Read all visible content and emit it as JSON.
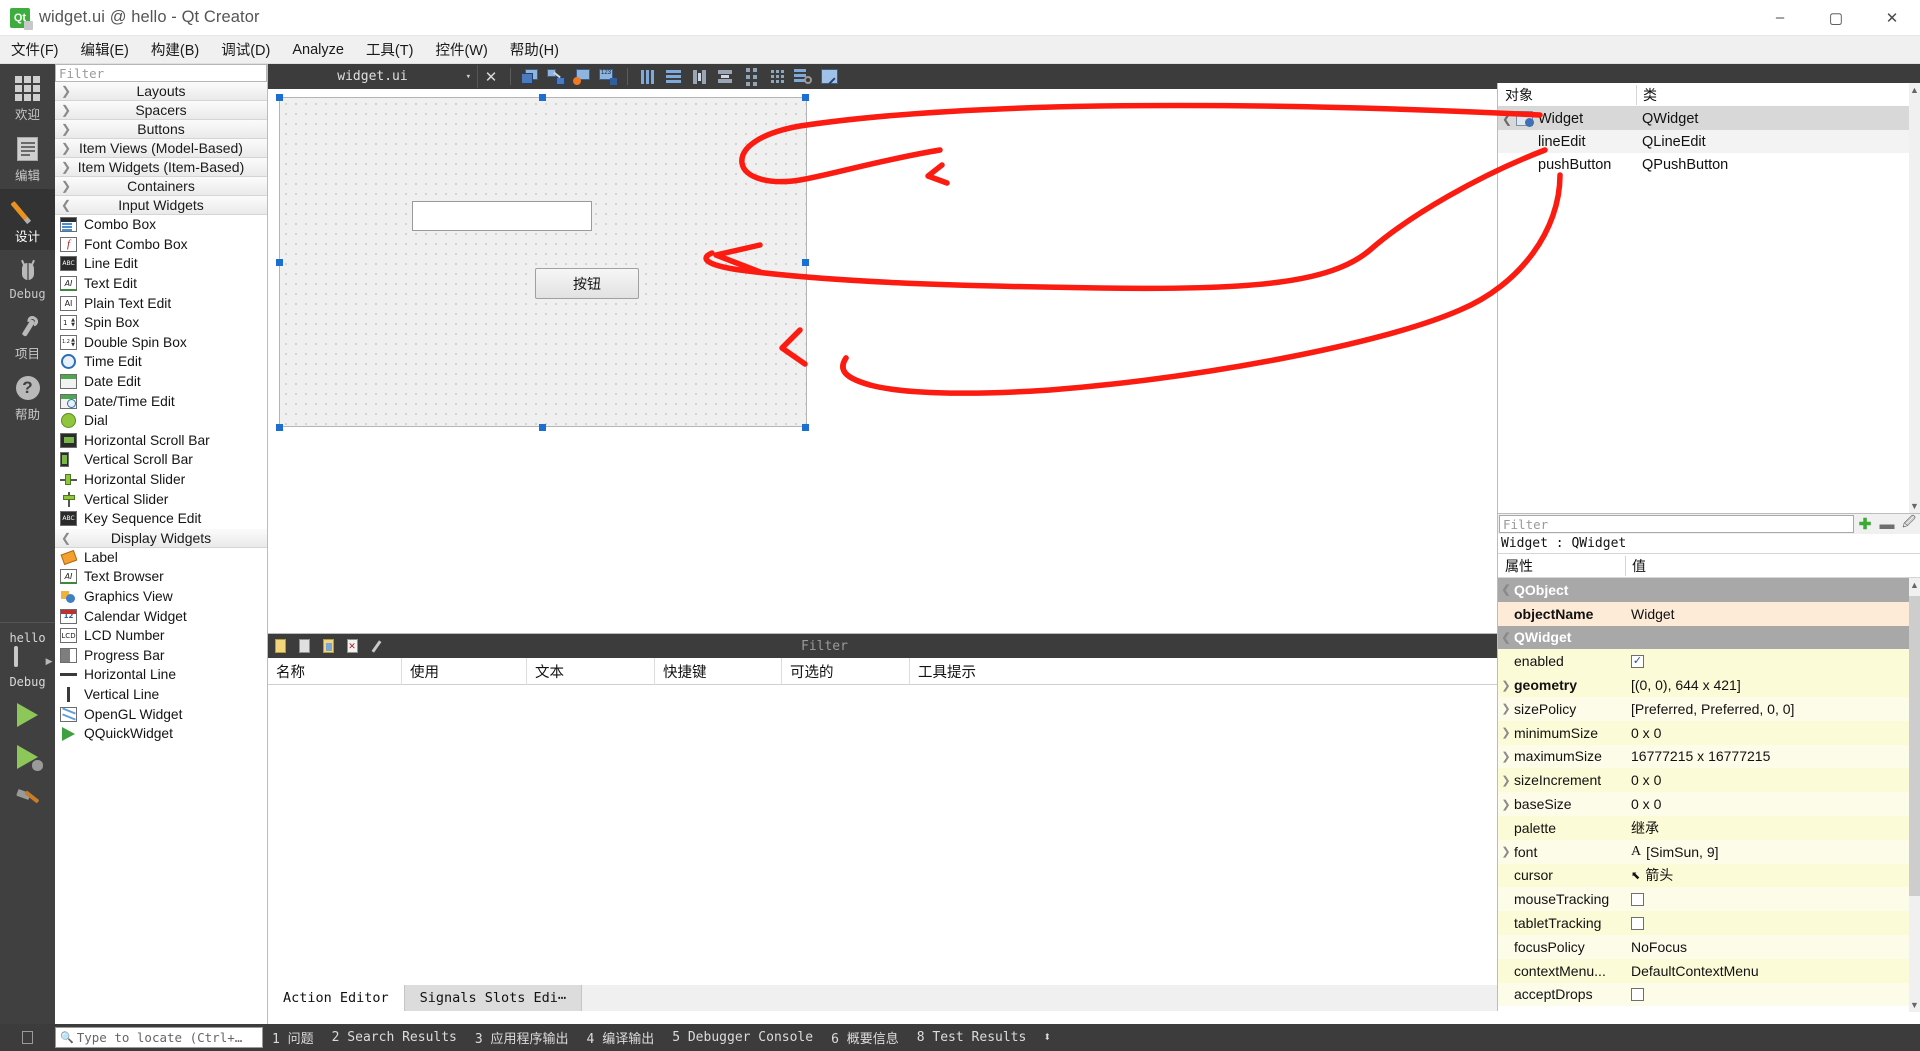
{
  "window": {
    "title": "widget.ui @ hello - Qt Creator",
    "app_icon": "qt-logo-icon",
    "minimize": "–",
    "maximize": "▢",
    "close": "✕"
  },
  "menubar": {
    "items": [
      {
        "label": "文件(F)",
        "name": "menu-file"
      },
      {
        "label": "编辑(E)",
        "name": "menu-edit"
      },
      {
        "label": "构建(B)",
        "name": "menu-build"
      },
      {
        "label": "调试(D)",
        "name": "menu-debug"
      },
      {
        "label": "Analyze",
        "name": "menu-analyze"
      },
      {
        "label": "工具(T)",
        "name": "menu-tools"
      },
      {
        "label": "控件(W)",
        "name": "menu-window"
      },
      {
        "label": "帮助(H)",
        "name": "menu-help"
      }
    ]
  },
  "modebar": {
    "modes": [
      {
        "label": "欢迎",
        "icon": "grid-icon",
        "active": false
      },
      {
        "label": "编辑",
        "icon": "document-icon",
        "active": false
      },
      {
        "label": "设计",
        "icon": "pencil-icon",
        "active": true
      },
      {
        "label": "Debug",
        "icon": "bug-icon",
        "active": false
      },
      {
        "label": "项目",
        "icon": "wrench-icon",
        "active": false
      },
      {
        "label": "帮助",
        "icon": "question-icon",
        "active": false
      }
    ],
    "kit": {
      "project": "hello",
      "config": "Debug",
      "icon": "monitor-icon"
    },
    "run_buttons": [
      {
        "name": "run-button",
        "icon": "play-icon"
      },
      {
        "name": "debug-button",
        "icon": "play-bug-icon"
      },
      {
        "name": "build-button",
        "icon": "hammer-icon"
      }
    ]
  },
  "widgetbox": {
    "filter_placeholder": "Filter",
    "groups": [
      {
        "label": "Layouts",
        "expanded": false
      },
      {
        "label": "Spacers",
        "expanded": false
      },
      {
        "label": "Buttons",
        "expanded": false
      },
      {
        "label": "Item Views (Model-Based)",
        "expanded": false
      },
      {
        "label": "Item Widgets (Item-Based)",
        "expanded": false
      },
      {
        "label": "Containers",
        "expanded": false
      },
      {
        "label": "Input Widgets",
        "expanded": true,
        "items": [
          {
            "label": "Combo Box",
            "icon": "combobox-icon"
          },
          {
            "label": "Font Combo Box",
            "icon": "fontcombobox-icon"
          },
          {
            "label": "Line Edit",
            "icon": "lineedit-icon"
          },
          {
            "label": "Text Edit",
            "icon": "textedit-icon"
          },
          {
            "label": "Plain Text Edit",
            "icon": "plaintextedit-icon"
          },
          {
            "label": "Spin Box",
            "icon": "spinbox-icon"
          },
          {
            "label": "Double Spin Box",
            "icon": "doublespinbox-icon"
          },
          {
            "label": "Time Edit",
            "icon": "clock-icon"
          },
          {
            "label": "Date Edit",
            "icon": "calendar-icon"
          },
          {
            "label": "Date/Time Edit",
            "icon": "calendar-clock-icon"
          },
          {
            "label": "Dial",
            "icon": "dial-icon"
          },
          {
            "label": "Horizontal Scroll Bar",
            "icon": "hscrollbar-icon"
          },
          {
            "label": "Vertical Scroll Bar",
            "icon": "vscrollbar-icon"
          },
          {
            "label": "Horizontal Slider",
            "icon": "hslider-icon"
          },
          {
            "label": "Vertical Slider",
            "icon": "vslider-icon"
          },
          {
            "label": "Key Sequence Edit",
            "icon": "keysequence-icon"
          }
        ]
      },
      {
        "label": "Display Widgets",
        "expanded": true,
        "items": [
          {
            "label": "Label",
            "icon": "label-icon"
          },
          {
            "label": "Text Browser",
            "icon": "textbrowser-icon"
          },
          {
            "label": "Graphics View",
            "icon": "graphicsview-icon"
          },
          {
            "label": "Calendar Widget",
            "icon": "calendarwidget-icon"
          },
          {
            "label": "LCD Number",
            "icon": "lcdnumber-icon"
          },
          {
            "label": "Progress Bar",
            "icon": "progressbar-icon"
          },
          {
            "label": "Horizontal Line",
            "icon": "hline-icon"
          },
          {
            "label": "Vertical Line",
            "icon": "vline-icon"
          },
          {
            "label": "OpenGL Widget",
            "icon": "opengl-icon"
          },
          {
            "label": "QQuickWidget",
            "icon": "qquickwidget-icon"
          }
        ]
      }
    ]
  },
  "designer_toolbar": {
    "file_combo": "widget.ui",
    "buttons": [
      {
        "name": "close-document-button",
        "icon": "close-icon"
      },
      {
        "name": "edit-widgets-button",
        "icon": "edit-widgets-icon"
      },
      {
        "name": "edit-signals-slots-button",
        "icon": "signals-slots-icon"
      },
      {
        "name": "edit-buddies-button",
        "icon": "buddies-icon"
      },
      {
        "name": "edit-tab-order-button",
        "icon": "tab-order-icon"
      },
      {
        "name": "layout-horizontally-button",
        "icon": "layout-h-icon"
      },
      {
        "name": "layout-vertically-button",
        "icon": "layout-v-icon"
      },
      {
        "name": "layout-splitter-h-button",
        "icon": "splitter-h-icon"
      },
      {
        "name": "layout-splitter-v-button",
        "icon": "splitter-v-icon"
      },
      {
        "name": "layout-form-button",
        "icon": "layout-form-icon"
      },
      {
        "name": "layout-grid-button",
        "icon": "layout-grid-icon"
      },
      {
        "name": "break-layout-button",
        "icon": "break-layout-icon"
      },
      {
        "name": "adjust-size-button",
        "icon": "adjust-size-icon"
      }
    ]
  },
  "form": {
    "lineedit": {
      "name": "lineEdit",
      "text": ""
    },
    "pushbutton": {
      "name": "pushButton",
      "text": "按钮"
    }
  },
  "object_inspector": {
    "columns": [
      "对象",
      "类"
    ],
    "rows": [
      {
        "name": "Widget",
        "class": "QWidget",
        "depth": 0,
        "selected": true,
        "expanded": true
      },
      {
        "name": "lineEdit",
        "class": "QLineEdit",
        "depth": 1,
        "selected": false
      },
      {
        "name": "pushButton",
        "class": "QPushButton",
        "depth": 1,
        "selected": false
      }
    ]
  },
  "property_editor": {
    "filter_placeholder": "Filter",
    "object_header": "Widget : QWidget",
    "columns": [
      "属性",
      "值"
    ],
    "toolbar": [
      {
        "name": "add-dynamic-property-button",
        "icon": "plus-icon",
        "color": "#3aaa35"
      },
      {
        "name": "remove-dynamic-property-button",
        "icon": "minus-icon",
        "color": "#6f6f6f"
      },
      {
        "name": "configure-button",
        "icon": "configure-icon",
        "color": "#6f6f6f"
      }
    ],
    "rows": [
      {
        "kind": "group",
        "name": "QObject"
      },
      {
        "kind": "prop",
        "name": "objectName",
        "value": "Widget",
        "style": "hl",
        "expandable": false
      },
      {
        "kind": "group",
        "name": "QWidget"
      },
      {
        "kind": "prop",
        "name": "enabled",
        "value": "",
        "style": "y",
        "checkbox": true,
        "checked": true
      },
      {
        "kind": "prop",
        "name": "geometry",
        "value": "[(0, 0), 644 x 421]",
        "style": "y",
        "expandable": true,
        "bold": true
      },
      {
        "kind": "prop",
        "name": "sizePolicy",
        "value": "[Preferred, Preferred, 0, 0]",
        "style": "ylight",
        "expandable": true
      },
      {
        "kind": "prop",
        "name": "minimumSize",
        "value": "0 x 0",
        "style": "y",
        "expandable": true
      },
      {
        "kind": "prop",
        "name": "maximumSize",
        "value": "16777215 x 16777215",
        "style": "ylight",
        "expandable": true
      },
      {
        "kind": "prop",
        "name": "sizeIncrement",
        "value": "0 x 0",
        "style": "y",
        "expandable": true
      },
      {
        "kind": "prop",
        "name": "baseSize",
        "value": "0 x 0",
        "style": "ylight",
        "expandable": true
      },
      {
        "kind": "prop",
        "name": "palette",
        "value": "继承",
        "style": "y"
      },
      {
        "kind": "prop",
        "name": "font",
        "value": "[SimSun, 9]",
        "style": "ylight",
        "expandable": true,
        "prefix": "A"
      },
      {
        "kind": "prop",
        "name": "cursor",
        "value": "箭头",
        "style": "y",
        "prefix": "cursor-arrow-icon"
      },
      {
        "kind": "prop",
        "name": "mouseTracking",
        "value": "",
        "style": "ylight",
        "checkbox": true,
        "checked": false
      },
      {
        "kind": "prop",
        "name": "tabletTracking",
        "value": "",
        "style": "y",
        "checkbox": true,
        "checked": false
      },
      {
        "kind": "prop",
        "name": "focusPolicy",
        "value": "NoFocus",
        "style": "ylight"
      },
      {
        "kind": "prop",
        "name": "contextMenu...",
        "value": "DefaultContextMenu",
        "style": "y"
      },
      {
        "kind": "prop",
        "name": "acceptDrops",
        "value": "",
        "style": "ylight",
        "checkbox": true,
        "checked": false
      }
    ]
  },
  "action_editor": {
    "filter_placeholder": "Filter",
    "toolbar": [
      {
        "name": "new-action-button",
        "icon": "new-icon"
      },
      {
        "name": "copy-action-button",
        "icon": "copy-icon"
      },
      {
        "name": "paste-action-button",
        "icon": "paste-icon"
      },
      {
        "name": "delete-action-button",
        "icon": "delete-icon"
      },
      {
        "name": "edit-action-button",
        "icon": "edit-icon"
      }
    ],
    "columns": [
      "名称",
      "使用",
      "文本",
      "快捷键",
      "可选的",
      "工具提示"
    ],
    "tabs": [
      {
        "label": "Action Editor",
        "active": true
      },
      {
        "label": "Signals  Slots Edi⋯",
        "active": false
      }
    ]
  },
  "statusbar": {
    "locator_placeholder": "Type to locate (Ctrl+…",
    "locator_icon": "search-icon",
    "panes": [
      "1 问题",
      "2 Search Results",
      "3 应用程序输出",
      "4 编译输出",
      "5 Debugger Console",
      "6 概要信息",
      "8 Test Results"
    ],
    "updown": "⬍"
  },
  "annotations": {
    "color": "#fc1b10",
    "strokes": [
      "widget-arrow",
      "lineedit-arrow",
      "pushbutton-arrow"
    ]
  }
}
